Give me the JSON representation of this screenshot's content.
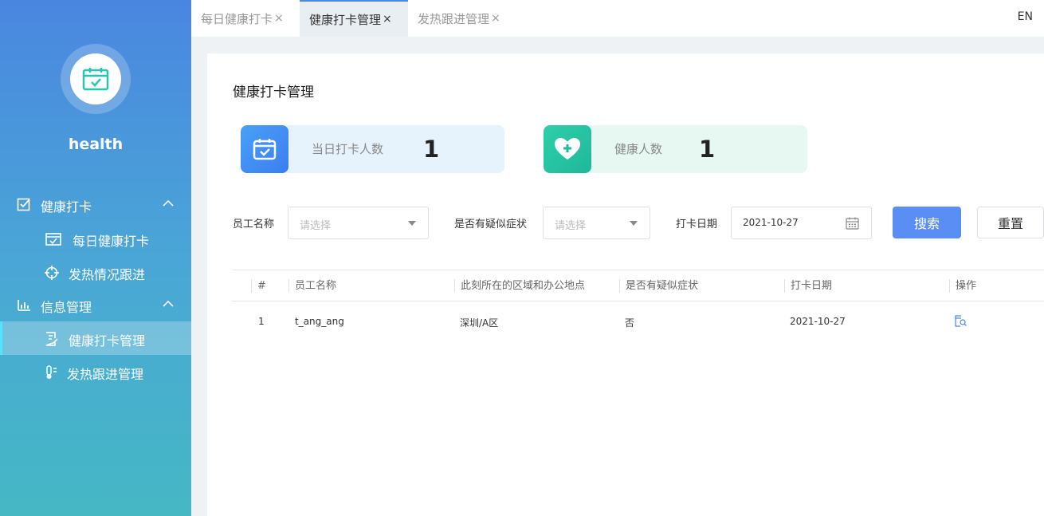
{
  "app": {
    "name": "health"
  },
  "sidebar": {
    "groups": [
      {
        "label": "健康打卡",
        "icon": "checkbox-icon",
        "items": [
          {
            "label": "每日健康打卡",
            "icon": "calendar-check-icon"
          },
          {
            "label": "发热情况跟进",
            "icon": "crosshair-icon"
          }
        ]
      },
      {
        "label": "信息管理",
        "icon": "bar-chart-icon",
        "items": [
          {
            "label": "健康打卡管理",
            "icon": "document-edit-icon",
            "active": true
          },
          {
            "label": "发热跟进管理",
            "icon": "thermometer-icon"
          }
        ]
      }
    ]
  },
  "tabs": [
    {
      "label": "每日健康打卡",
      "close": "×"
    },
    {
      "label": "健康打卡管理",
      "close": "×",
      "active": true
    },
    {
      "label": "发热跟进管理",
      "close": "×"
    }
  ],
  "lang_toggle": "EN",
  "page": {
    "title": "健康打卡管理"
  },
  "stats": [
    {
      "label": "当日打卡人数",
      "value": "1",
      "icon": "calendar-check-icon",
      "color": "#3b8cf5",
      "bg": "#e6f2fc"
    },
    {
      "label": "健康人数",
      "value": "1",
      "icon": "heart-plus-icon",
      "color": "#26c6a6",
      "bg": "#e6f8f1"
    }
  ],
  "filters": {
    "employee": {
      "label": "员工名称",
      "placeholder": "请选择"
    },
    "symptom": {
      "label": "是否有疑似症状",
      "placeholder": "请选择"
    },
    "date": {
      "label": "打卡日期",
      "value": "2021-10-27"
    },
    "search_label": "搜索",
    "reset_label": "重置"
  },
  "table": {
    "headers": [
      "#",
      "员工名称",
      "此刻所在的区域和办公地点",
      "是否有疑似症状",
      "打卡日期",
      "操作"
    ],
    "rows": [
      {
        "index": "1",
        "name": "t_ang_ang",
        "location": "深圳/A区",
        "symptom": "否",
        "date": "2021-10-27"
      }
    ]
  },
  "colors": {
    "accent": "#5b8ef5",
    "sidebar_top": "#4a86e0",
    "sidebar_bottom": "#45b8c4"
  }
}
